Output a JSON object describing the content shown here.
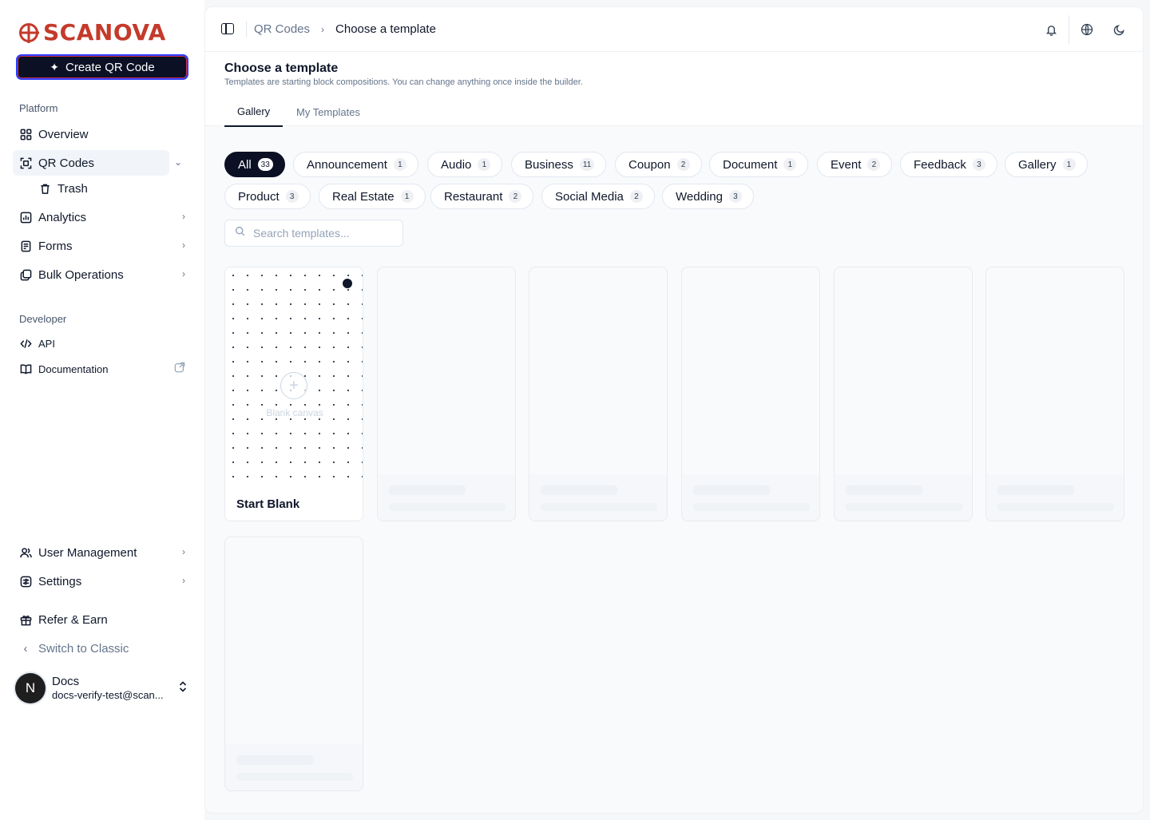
{
  "brand": {
    "name": "SCANOVA",
    "color": "#c43a2b"
  },
  "sidebar": {
    "create_button": "Create QR Code",
    "platform_label": "Platform",
    "items": [
      {
        "label": "Overview",
        "icon": "grid-icon"
      },
      {
        "label": "QR Codes",
        "icon": "qr-scan-icon",
        "expanded": true
      },
      {
        "label": "Trash",
        "icon": "trash-icon"
      },
      {
        "label": "Analytics",
        "icon": "chart-icon"
      },
      {
        "label": "Forms",
        "icon": "form-icon"
      },
      {
        "label": "Bulk Operations",
        "icon": "bulk-icon"
      }
    ],
    "developer_label": "Developer",
    "dev_items": [
      {
        "label": "API",
        "icon": "code-icon"
      },
      {
        "label": "Documentation",
        "icon": "book-icon"
      }
    ],
    "bottom_items": [
      {
        "label": "User Management",
        "icon": "users-icon"
      },
      {
        "label": "Settings",
        "icon": "settings-icon"
      },
      {
        "label": "Refer & Earn",
        "icon": "gift-icon"
      },
      {
        "label": "Switch to Classic",
        "icon": "chevron-left-icon"
      }
    ],
    "user": {
      "initial": "N",
      "name": "Docs",
      "email": "docs-verify-test@scan..."
    }
  },
  "topbar": {
    "breadcrumb_parent": "QR Codes",
    "breadcrumb_current": "Choose a template"
  },
  "page": {
    "title": "Choose a template",
    "subtitle": "Templates are starting block compositions. You can change anything once inside the builder.",
    "tabs": [
      "Gallery",
      "My Templates"
    ]
  },
  "filters": [
    {
      "label": "All",
      "count": "33",
      "active": true
    },
    {
      "label": "Announcement",
      "count": "1"
    },
    {
      "label": "Audio",
      "count": "1"
    },
    {
      "label": "Business",
      "count": "11"
    },
    {
      "label": "Coupon",
      "count": "2"
    },
    {
      "label": "Document",
      "count": "1"
    },
    {
      "label": "Event",
      "count": "2"
    },
    {
      "label": "Feedback",
      "count": "3"
    },
    {
      "label": "Gallery",
      "count": "1"
    },
    {
      "label": "Product",
      "count": "3"
    },
    {
      "label": "Real Estate",
      "count": "1"
    },
    {
      "label": "Restaurant",
      "count": "2"
    },
    {
      "label": "Social Media",
      "count": "2"
    },
    {
      "label": "Wedding",
      "count": "3"
    }
  ],
  "search": {
    "placeholder": "Search templates..."
  },
  "blank_card": {
    "caption": "Blank canvas",
    "label": "Start Blank"
  }
}
